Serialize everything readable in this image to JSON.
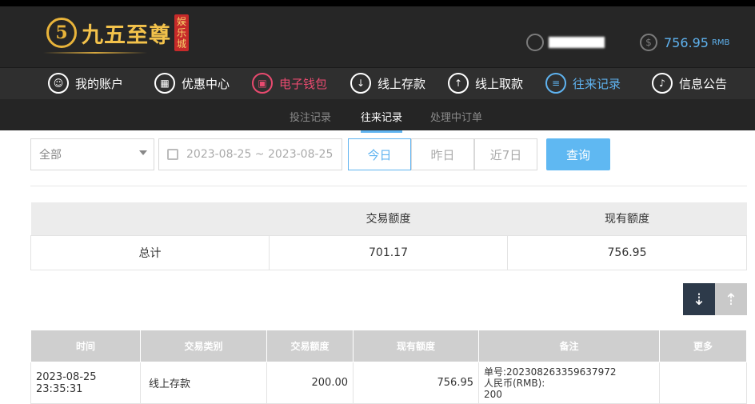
{
  "brand": {
    "badge": "5",
    "name": "九五至尊",
    "sub": "娱乐城"
  },
  "header": {
    "balance": "756.95",
    "currency": "RMB"
  },
  "nav": [
    {
      "label": "我的账户",
      "icon": "user-icon"
    },
    {
      "label": "优惠中心",
      "icon": "gift-icon"
    },
    {
      "label": "电子钱包",
      "icon": "wallet-icon"
    },
    {
      "label": "线上存款",
      "icon": "deposit-icon"
    },
    {
      "label": "线上取款",
      "icon": "withdraw-icon"
    },
    {
      "label": "往来记录",
      "icon": "records-icon"
    },
    {
      "label": "信息公告",
      "icon": "bell-icon"
    }
  ],
  "subtabs": [
    "投注记录",
    "往来记录",
    "处理中订单"
  ],
  "filter": {
    "type": "全部",
    "date": "2023-08-25 ~ 2023-08-25",
    "today": "今日",
    "yesterday": "昨日",
    "last7": "近7日",
    "query": "查询"
  },
  "summary": {
    "headers": [
      "",
      "交易额度",
      "现有额度"
    ],
    "row": [
      "总计",
      "701.17",
      "756.95"
    ]
  },
  "table": {
    "headers": [
      "时间",
      "交易类别",
      "交易额度",
      "现有额度",
      "备注",
      "更多"
    ],
    "rows": [
      {
        "time": "2023-08-25 23:35:31",
        "type": "线上存款",
        "amount": "200.00",
        "balance": "756.95",
        "memo1": "单号:202308263359637972",
        "memo2": "人民币(RMB):",
        "memo3": "200",
        "more": ""
      }
    ]
  }
}
